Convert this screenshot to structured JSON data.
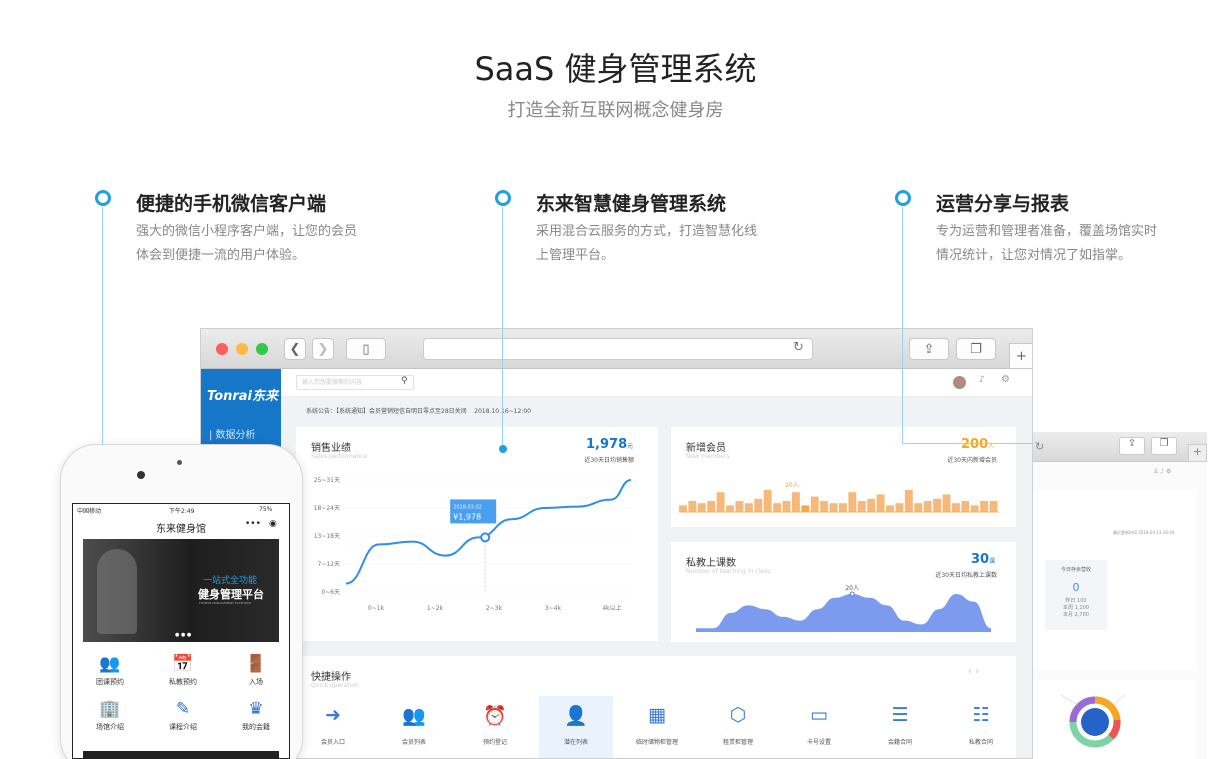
{
  "hero": {
    "title": "SaaS 健身管理系统",
    "subtitle": "打造全新互联网概念健身房"
  },
  "features": [
    {
      "title": "便捷的手机微信客户端",
      "desc": "强大的微信小程序客户端，让您的会员 体会到便捷一流的用户体验。"
    },
    {
      "title": "东来智慧健身管理系统",
      "desc": "采用混合云服务的方式，打造智慧化线上管理平台。"
    },
    {
      "title": "运营分享与报表",
      "desc": "专为运营和管理者准备，覆盖场馆实时 情况统计，让您对情况了如指掌。"
    }
  ],
  "dashboard": {
    "logo": "Tonrai东来",
    "nav_item": "| 数据分析",
    "search_placeholder": "输入您想要搜索的内容",
    "notice": "系统公告：【系统通知】会员营销短信自明日零点至28日关闭",
    "notice_date": "2018.10.16~12:00",
    "sales": {
      "title": "销售业绩",
      "subtitle": "Sales performance",
      "value": "1,978",
      "unit": "元",
      "caption": "近30天日均销售额",
      "tooltip_date": "2018.03.02",
      "tooltip_value": "¥1,978"
    },
    "members": {
      "title": "新增会员",
      "subtitle": "New members",
      "value": "200",
      "unit": "人",
      "caption": "近30天内新增会员",
      "peak_label": "20人"
    },
    "classes": {
      "title": "私教上课数",
      "subtitle": "Number of teaching in class",
      "value": "30",
      "unit": "课",
      "caption": "近30天日均私教上课数",
      "peak_label": "20人"
    },
    "quick": {
      "title": "快捷操作",
      "subtitle": "Quick operation",
      "items": [
        {
          "label": "会员入口",
          "icon": "login-icon",
          "glyph": "➜"
        },
        {
          "label": "会员列表",
          "icon": "users-icon",
          "glyph": "👥"
        },
        {
          "label": "预约登记",
          "icon": "alarm-icon",
          "glyph": "⏰"
        },
        {
          "label": "潜在列表",
          "icon": "prospect-icon",
          "glyph": "👤"
        },
        {
          "label": "临时储物柜管理",
          "icon": "apps-icon",
          "glyph": "▦"
        },
        {
          "label": "租赁柜管理",
          "icon": "box-icon",
          "glyph": "⬡"
        },
        {
          "label": "卡号设置",
          "icon": "card-icon",
          "glyph": "▭"
        },
        {
          "label": "会籍合同",
          "icon": "contract-icon",
          "glyph": "☰"
        },
        {
          "label": "私教合同",
          "icon": "doc-user-icon",
          "glyph": "☷"
        }
      ]
    }
  },
  "chart_data": [
    {
      "type": "line",
      "title": "销售业绩",
      "categories": [
        "0~1k",
        "1~2k",
        "2~3k",
        "3~4k",
        "4k以上"
      ],
      "y_ticks": [
        "0~6天",
        "7~12天",
        "13~18天",
        "18~24天",
        "25~31天"
      ],
      "x": [
        0,
        0.5,
        1,
        1.5,
        2,
        2.5,
        3,
        3.5,
        4,
        4.3
      ],
      "y": [
        0.3,
        1.7,
        1.8,
        1.3,
        1.95,
        2.6,
        3.0,
        3.05,
        3.3,
        4.0
      ]
    },
    {
      "type": "bar",
      "title": "新增会员",
      "values": [
        3,
        5,
        4,
        5,
        9,
        3,
        5,
        4,
        6,
        10,
        4,
        5,
        9,
        3,
        7,
        5,
        4,
        4,
        9,
        5,
        6,
        8,
        3,
        4,
        10,
        4,
        5,
        6,
        8,
        4,
        5,
        3,
        5,
        5
      ]
    },
    {
      "type": "area",
      "title": "私教上课数",
      "values": [
        1,
        1,
        5,
        7,
        6,
        4,
        3,
        6,
        9,
        10,
        9,
        7,
        3,
        2,
        6,
        10,
        8,
        1
      ]
    }
  ],
  "phone": {
    "carrier": "中国移动",
    "time": "下午2:49",
    "battery": "75%",
    "title": "东来健身馆",
    "banner_line1": "一站式全功能",
    "banner_line2": "健身管理平台",
    "banner_line3": "FITNESS MANAGEMENT PLATFORM",
    "items": [
      {
        "label": "团课预约",
        "icon": "group-class-icon",
        "glyph": "👥"
      },
      {
        "label": "私教预约",
        "icon": "calendar-icon",
        "glyph": "📅"
      },
      {
        "label": "入场",
        "icon": "door-icon",
        "glyph": "🚪"
      },
      {
        "label": "场馆介绍",
        "icon": "building-icon",
        "glyph": "🏢"
      },
      {
        "label": "课程介绍",
        "icon": "dumbbell-icon",
        "glyph": "✎"
      },
      {
        "label": "我的会籍",
        "icon": "crown-icon",
        "glyph": "♛"
      }
    ]
  },
  "report": {
    "title": "今日存余营收",
    "value": "0",
    "line1": "昨日 100",
    "line2": "本周 1,100",
    "line3": "本月 2,700",
    "updated": "最近更新时间 2018-04-13 16:40"
  }
}
